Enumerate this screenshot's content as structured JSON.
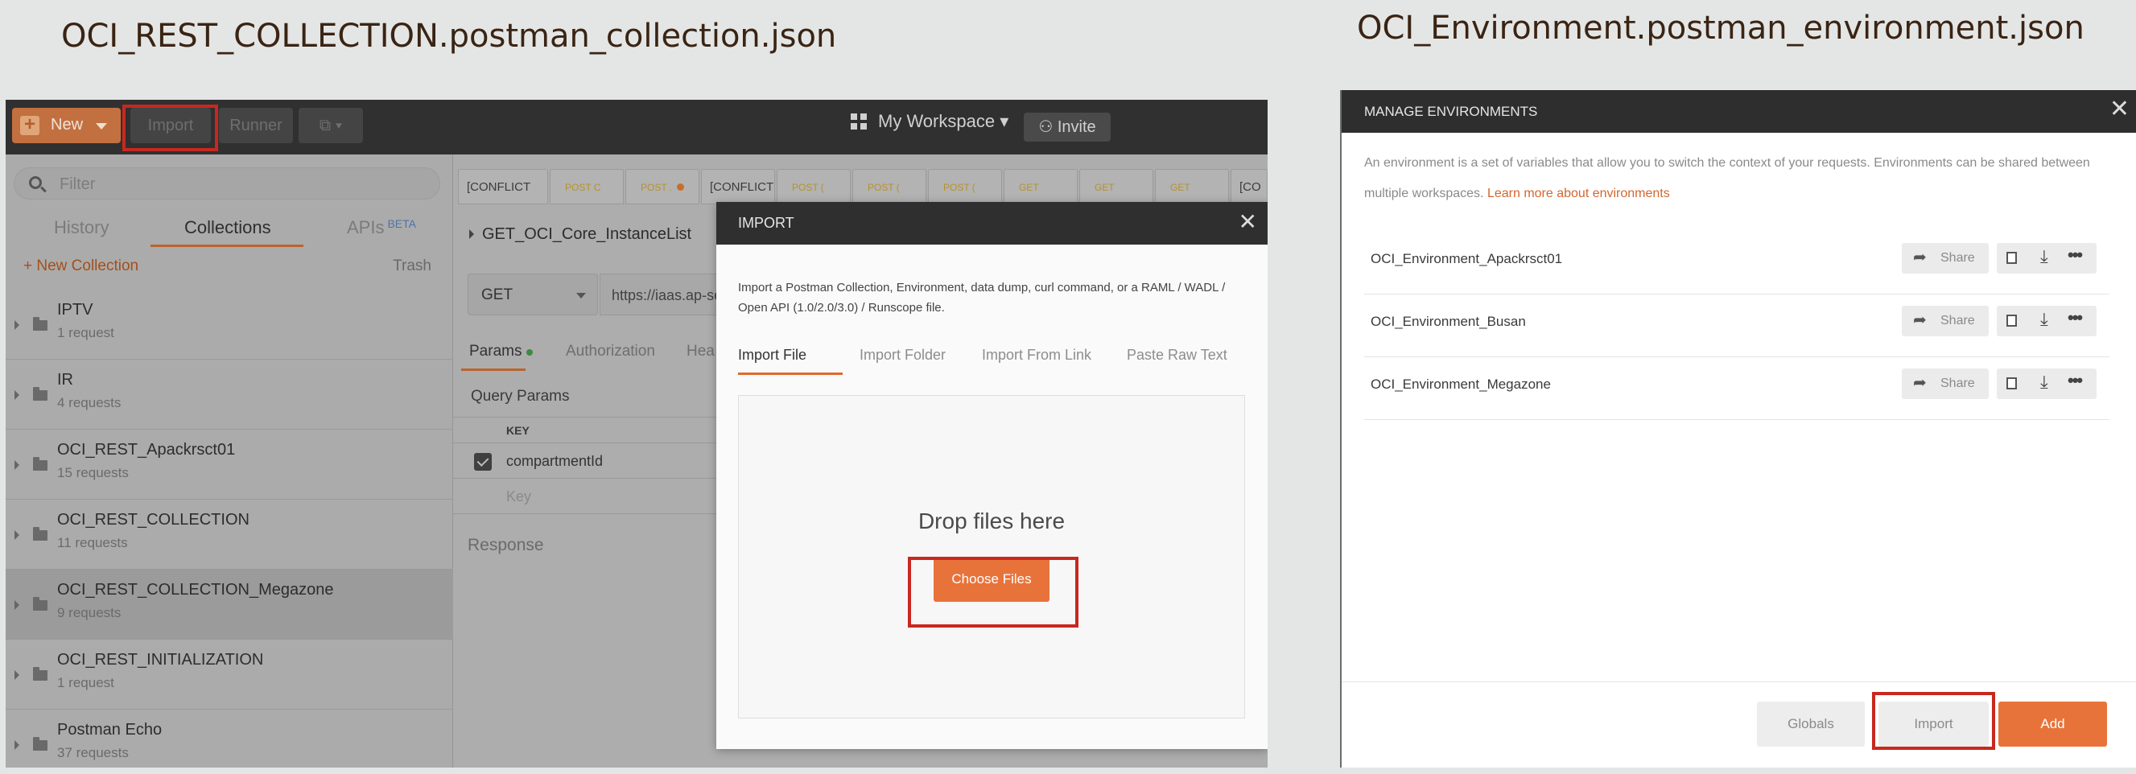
{
  "captions": {
    "left": "OCI_REST_COLLECTION.postman_collection.json",
    "right": "OCI_Environment.postman_environment.json"
  },
  "postman": {
    "toolbar": {
      "new_label": "New",
      "import_label": "Import",
      "runner_label": "Runner",
      "workspace_label": "My Workspace",
      "invite_label": "Invite"
    },
    "sidebar": {
      "filter_placeholder": "Filter",
      "tabs": [
        "History",
        "Collections",
        "APIs"
      ],
      "beta_badge": "BETA",
      "new_collection_label": "+ New Collection",
      "trash_label": "Trash",
      "collections": [
        {
          "name": "IPTV",
          "count": "1 request"
        },
        {
          "name": "IR",
          "count": "4 requests"
        },
        {
          "name": "OCI_REST_Apackrsct01",
          "count": "15 requests"
        },
        {
          "name": "OCI_REST_COLLECTION",
          "count": "11 requests"
        },
        {
          "name": "OCI_REST_COLLECTION_Megazone",
          "count": "9 requests"
        },
        {
          "name": "OCI_REST_INITIALIZATION",
          "count": "1 request"
        },
        {
          "name": "Postman Echo",
          "count": "37 requests"
        }
      ]
    },
    "main": {
      "request_tabs": [
        {
          "label": "[CONFLICT",
          "method": ""
        },
        {
          "label": "",
          "method": "POST C"
        },
        {
          "label": "",
          "method": "POST ."
        },
        {
          "label": "[CONFLICT",
          "method": ""
        },
        {
          "label": "",
          "method": "POST ("
        },
        {
          "label": "",
          "method": "POST ("
        },
        {
          "label": "",
          "method": "POST ("
        },
        {
          "label": "",
          "method": "GET"
        },
        {
          "label": "",
          "method": "GET"
        },
        {
          "label": "",
          "method": "GET"
        },
        {
          "label": "[CO",
          "method": ""
        }
      ],
      "request_name": "GET_OCI_Core_InstanceList",
      "method": "GET",
      "url": "https://iaas.ap-se",
      "subtabs": [
        "Params",
        "Authorization",
        "Hea"
      ],
      "query_params_title": "Query Params",
      "key_header": "KEY",
      "param_key": "compartmentId",
      "key_placeholder": "Key",
      "response_label": "Response"
    },
    "import_modal": {
      "title": "IMPORT",
      "close_glyph": "✕",
      "description": "Import a Postman Collection, Environment, data dump, curl command, or a RAML / WADL / Open API (1.0/2.0/3.0) / Runscope file.",
      "tabs": [
        "Import File",
        "Import Folder",
        "Import From Link",
        "Paste Raw Text"
      ],
      "drop_text": "Drop files here",
      "choose_files_label": "Choose Files"
    }
  },
  "environments": {
    "title": "MANAGE ENVIRONMENTS",
    "close_glyph": "✕",
    "description": "An environment is a set of variables that allow you to switch the context of your requests. Environments can be shared between multiple workspaces.",
    "learn_more": "Learn more about environments",
    "items": [
      {
        "name": "OCI_Environment_Apackrsct01"
      },
      {
        "name": "OCI_Environment_Busan"
      },
      {
        "name": "OCI_Environment_Megazone"
      }
    ],
    "share_label": "Share",
    "globals_label": "Globals",
    "import_label": "Import",
    "add_label": "Add"
  },
  "colors": {
    "accent_orange": "#e8733a",
    "highlight_red": "#c8281f",
    "header_dark": "#2f2f2f"
  }
}
